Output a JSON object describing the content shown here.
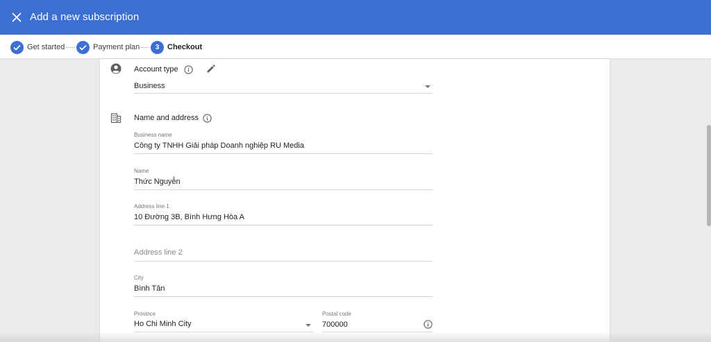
{
  "appbar": {
    "title": "Add a new subscription",
    "close_icon": "close-icon"
  },
  "stepper": {
    "steps": [
      {
        "label": "Get started",
        "state": "complete",
        "icon": "check-icon"
      },
      {
        "label": "Payment plan",
        "state": "complete",
        "icon": "check-icon"
      },
      {
        "label": "Checkout",
        "state": "active",
        "number": "3"
      }
    ]
  },
  "account_type": {
    "title": "Account type",
    "icon": "account-circle-icon",
    "value": "Business"
  },
  "name_address": {
    "title": "Name and address",
    "icon": "building-icon",
    "business_name": {
      "label": "Business name",
      "value": "Công ty TNHH Giải pháp Doanh nghiệp RU Media"
    },
    "name": {
      "label": "Name",
      "value": "Thức Nguyễn"
    },
    "address1": {
      "label": "Address line 1",
      "value": "10 Đường 3B, Bình Hưng Hòa A"
    },
    "address2": {
      "placeholder": "Address line 2"
    },
    "city": {
      "label": "City",
      "value": "Bình Tân"
    },
    "province": {
      "label": "Province",
      "value": "Ho Chi Minh City"
    },
    "postal_code": {
      "label": "Postal code",
      "value": "700000"
    }
  },
  "colors": {
    "primary": "#3b6fd4",
    "background": "#ebebeb",
    "card": "#ffffff"
  }
}
